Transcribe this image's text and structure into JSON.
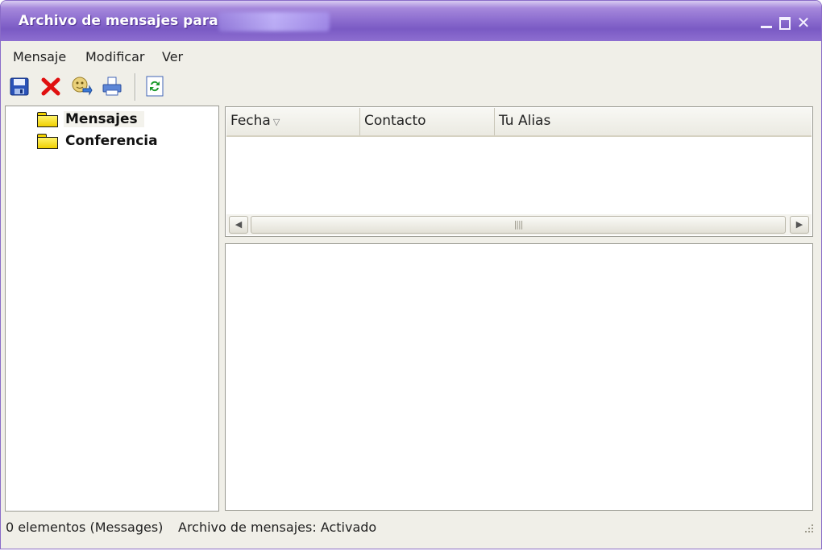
{
  "window": {
    "title": "Archivo de mensajes para",
    "controls": {
      "minimize": "_",
      "maximize": "□",
      "close": "✕"
    }
  },
  "menu": [
    "Mensaje",
    "Modificar",
    "Ver"
  ],
  "toolbar": {
    "buttons": [
      "save-icon",
      "delete-icon",
      "contact-icon",
      "print-icon",
      "refresh-icon"
    ]
  },
  "tree": {
    "items": [
      {
        "label": "Mensajes",
        "selected": true
      },
      {
        "label": "Conferencia",
        "selected": false
      }
    ]
  },
  "list": {
    "columns": [
      "Fecha",
      "Contacto",
      "Tu Alias"
    ],
    "sort_indicator": "▽",
    "rows": []
  },
  "status": {
    "count": "0 elementos (Messages)",
    "archive": "Archivo de mensajes: Activado"
  },
  "colors": {
    "titlebar": "#8e6fd0",
    "chrome": "#f0efe8"
  }
}
